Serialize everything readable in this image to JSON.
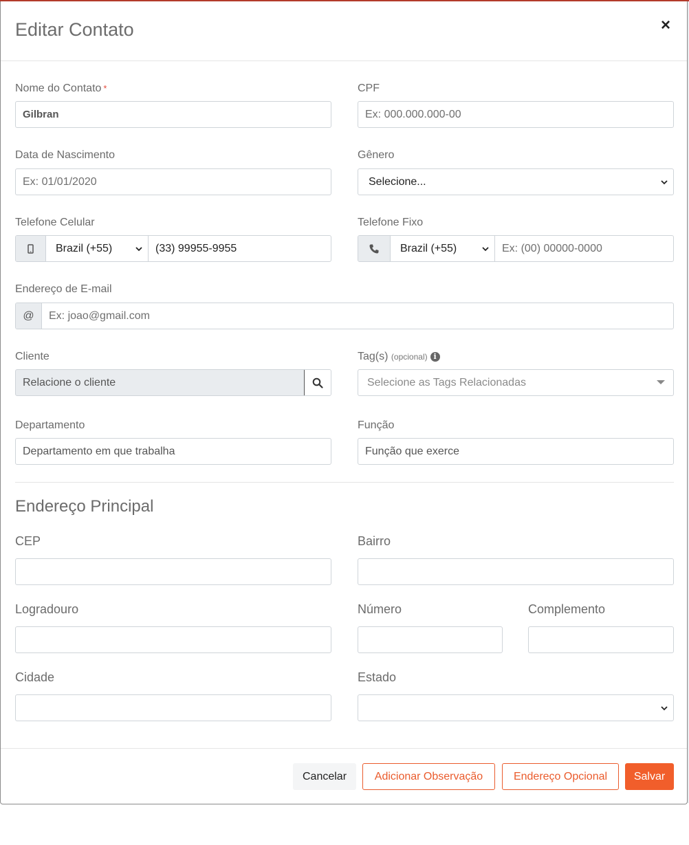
{
  "modal": {
    "title": "Editar Contato",
    "close_label": "×"
  },
  "fields": {
    "nome": {
      "label": "Nome do Contato",
      "required_mark": "*",
      "value": "Gilbran"
    },
    "cpf": {
      "label": "CPF",
      "placeholder": "Ex: 000.000.000-00"
    },
    "nascimento": {
      "label": "Data de Nascimento",
      "placeholder": "Ex: 01/01/2020"
    },
    "genero": {
      "label": "Gênero",
      "selected": "Selecione..."
    },
    "celular": {
      "label": "Telefone Celular",
      "country": "Brazil (+55)",
      "value": "(33) 99955-9955",
      "icon": "mobile-icon"
    },
    "fixo": {
      "label": "Telefone Fixo",
      "country": "Brazil (+55)",
      "placeholder": "Ex: (00) 00000-0000",
      "icon": "phone-icon"
    },
    "email": {
      "label": "Endereço de E-mail",
      "addon": "@",
      "placeholder": "Ex: joao@gmail.com"
    },
    "cliente": {
      "label": "Cliente",
      "placeholder": "Relacione o cliente",
      "icon": "search-icon"
    },
    "tags": {
      "label": "Tag(s)",
      "label_note": "(opcional)",
      "info": "i",
      "placeholder": "Selecione as Tags Relacionadas"
    },
    "departamento": {
      "label": "Departamento",
      "placeholder": "Departamento em que trabalha"
    },
    "funcao": {
      "label": "Função",
      "placeholder": "Função que exerce"
    }
  },
  "address": {
    "title": "Endereço Principal",
    "cep": {
      "label": "CEP",
      "value": ""
    },
    "bairro": {
      "label": "Bairro",
      "value": ""
    },
    "logradouro": {
      "label": "Logradouro",
      "value": ""
    },
    "numero": {
      "label": "Número",
      "value": ""
    },
    "complemento": {
      "label": "Complemento",
      "value": ""
    },
    "cidade": {
      "label": "Cidade",
      "value": ""
    },
    "estado": {
      "label": "Estado",
      "selected": ""
    }
  },
  "footer": {
    "cancel": "Cancelar",
    "add_note": "Adicionar Observação",
    "optional_address": "Endereço Opcional",
    "save": "Salvar"
  },
  "colors": {
    "accent": "#f15e2b",
    "accent_outline": "#ea5b2c",
    "required": "#e34b3c",
    "addon_bg": "#e9ecef"
  }
}
